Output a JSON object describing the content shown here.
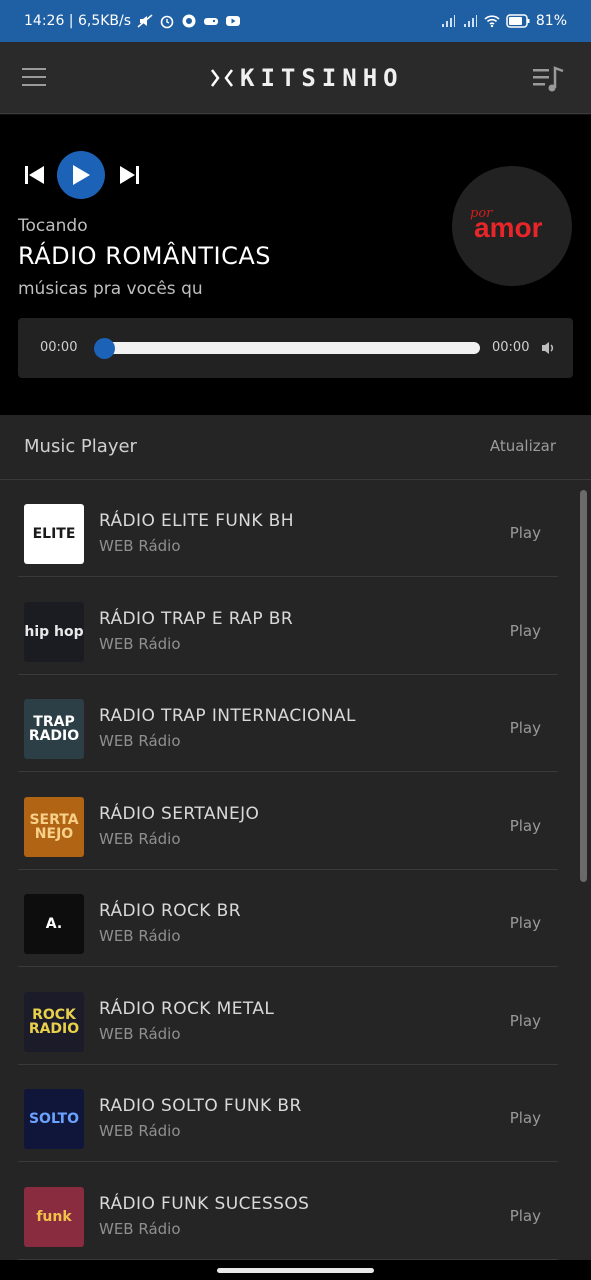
{
  "status_bar": {
    "time_net": "14:26 | 6,5KB/s",
    "battery": "81%"
  },
  "app": {
    "logo_text": "KITSINHO"
  },
  "player": {
    "status_label": "Tocando",
    "station_title": "RÁDIO ROMÂNTICAS",
    "description": "músicas pra vocês qu",
    "current_time": "00:00",
    "total_time": "00:00",
    "progress": 0,
    "cover_text": "amor",
    "cover_small": "por"
  },
  "list": {
    "title": "Music Player",
    "refresh_label": "Atualizar",
    "items": [
      {
        "name": "RÁDIO ELITE FUNK BH",
        "sub": "WEB Rádio",
        "action": "Play",
        "thumb_text": "ELITE",
        "thumb_bg": "#ffffff",
        "thumb_fg": "#1a1a1a"
      },
      {
        "name": "RÁDIO TRAP E RAP BR",
        "sub": "WEB Rádio",
        "action": "Play",
        "thumb_text": "hip hop",
        "thumb_bg": "#1b1b22",
        "thumb_fg": "#e8e8e8"
      },
      {
        "name": "RADIO TRAP INTERNACIONAL",
        "sub": "WEB Rádio",
        "action": "Play",
        "thumb_text": "TRAP RADIO",
        "thumb_bg": "#2c3e46",
        "thumb_fg": "#ffffff"
      },
      {
        "name": "RÁDIO SERTANEJO",
        "sub": "WEB Rádio",
        "action": "Play",
        "thumb_text": "SERTA NEJO",
        "thumb_bg": "#b06414",
        "thumb_fg": "#f7d08a"
      },
      {
        "name": "RÁDIO ROCK BR",
        "sub": "WEB Rádio",
        "action": "Play",
        "thumb_text": "A.",
        "thumb_bg": "#0d0d0d",
        "thumb_fg": "#ffffff"
      },
      {
        "name": "RÁDIO ROCK METAL",
        "sub": "WEB Rádio",
        "action": "Play",
        "thumb_text": "ROCK RADIO",
        "thumb_bg": "#1c1b2a",
        "thumb_fg": "#e8d14a"
      },
      {
        "name": "RADIO SOLTO FUNK BR",
        "sub": "WEB Rádio",
        "action": "Play",
        "thumb_text": "SOLTO",
        "thumb_bg": "#10163a",
        "thumb_fg": "#6aa3ff"
      },
      {
        "name": "RÁDIO FUNK SUCESSOS",
        "sub": "WEB Rádio",
        "action": "Play",
        "thumb_text": "funk",
        "thumb_bg": "#8a2c3f",
        "thumb_fg": "#f1c24a"
      }
    ]
  },
  "colors": {
    "accent": "#1c63b8",
    "status_bar": "#1f5fa3"
  }
}
